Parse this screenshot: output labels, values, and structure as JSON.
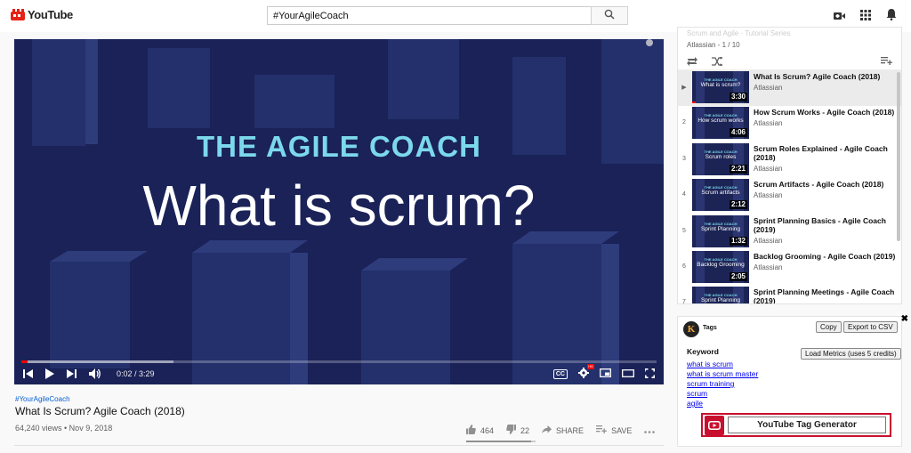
{
  "header": {
    "brand": "YouTube",
    "search_value": "#YourAgileCoach",
    "icons": [
      "video-camera-icon",
      "apps-grid-icon",
      "bell-icon"
    ]
  },
  "player": {
    "overlay_small": "THE AGILE COACH",
    "overlay_big": "What is scrum?",
    "time": "0:02 / 3:29",
    "played_fraction": 0.01,
    "buffered_fraction": 0.24,
    "cc_label": "CC",
    "hd_badge": "HD"
  },
  "video": {
    "hashtag": "#YourAgileCoach",
    "title": "What Is Scrum? Agile Coach (2018)",
    "meta": "64,240 views • Nov 9, 2018",
    "likes": "464",
    "dislikes": "22",
    "share_label": "SHARE",
    "save_label": "SAVE"
  },
  "playlist": {
    "faded_title": "Scrum and Agile · Tutorial Series",
    "subtitle": "Atlassian - 1 / 10",
    "items": [
      {
        "index": "▶",
        "title": "What Is Scrum? Agile Coach (2018)",
        "channel": "Atlassian",
        "duration": "3:30",
        "thumb_text": "What is scrum?",
        "active": true
      },
      {
        "index": "2",
        "title": "How Scrum Works - Agile Coach (2018)",
        "channel": "Atlassian",
        "duration": "4:06",
        "thumb_text": "How scrum works"
      },
      {
        "index": "3",
        "title": "Scrum Roles Explained - Agile Coach (2018)",
        "channel": "Atlassian",
        "duration": "2:21",
        "thumb_text": "Scrum roles"
      },
      {
        "index": "4",
        "title": "Scrum Artifacts - Agile Coach (2018)",
        "channel": "Atlassian",
        "duration": "2:12",
        "thumb_text": "Scrum artifacts"
      },
      {
        "index": "5",
        "title": "Sprint Planning Basics - Agile Coach (2019)",
        "channel": "Atlassian",
        "duration": "1:32",
        "thumb_text": "Sprint Planning"
      },
      {
        "index": "6",
        "title": "Backlog Grooming - Agile Coach (2019)",
        "channel": "Atlassian",
        "duration": "2:05",
        "thumb_text": "Backlog Grooming"
      },
      {
        "index": "7",
        "title": "Sprint Planning Meetings - Agile Coach (2019)",
        "channel": "Atlassian",
        "duration": "",
        "thumb_text": "Sprint Planning"
      }
    ],
    "thumb_header": "THE AGILE COACH"
  },
  "tags_panel": {
    "logo_letter": "K",
    "label": "Tags",
    "copy_label": "Copy",
    "export_label": "Export to CSV",
    "load_label": "Load Metrics (uses 5 credits)",
    "keyword_header": "Keyword",
    "keywords": [
      "what is scrum",
      "what is scrum master",
      "scrum training",
      "scrum",
      "agile"
    ],
    "banner": "YouTube Tag Generator",
    "close": "✖"
  },
  "colors": {
    "player_bg": "#1a2257",
    "accent_cyan": "#7cd8ec",
    "progress_red": "#ff0000",
    "link_blue": "#065fd4",
    "banner_red": "#c8102e"
  }
}
